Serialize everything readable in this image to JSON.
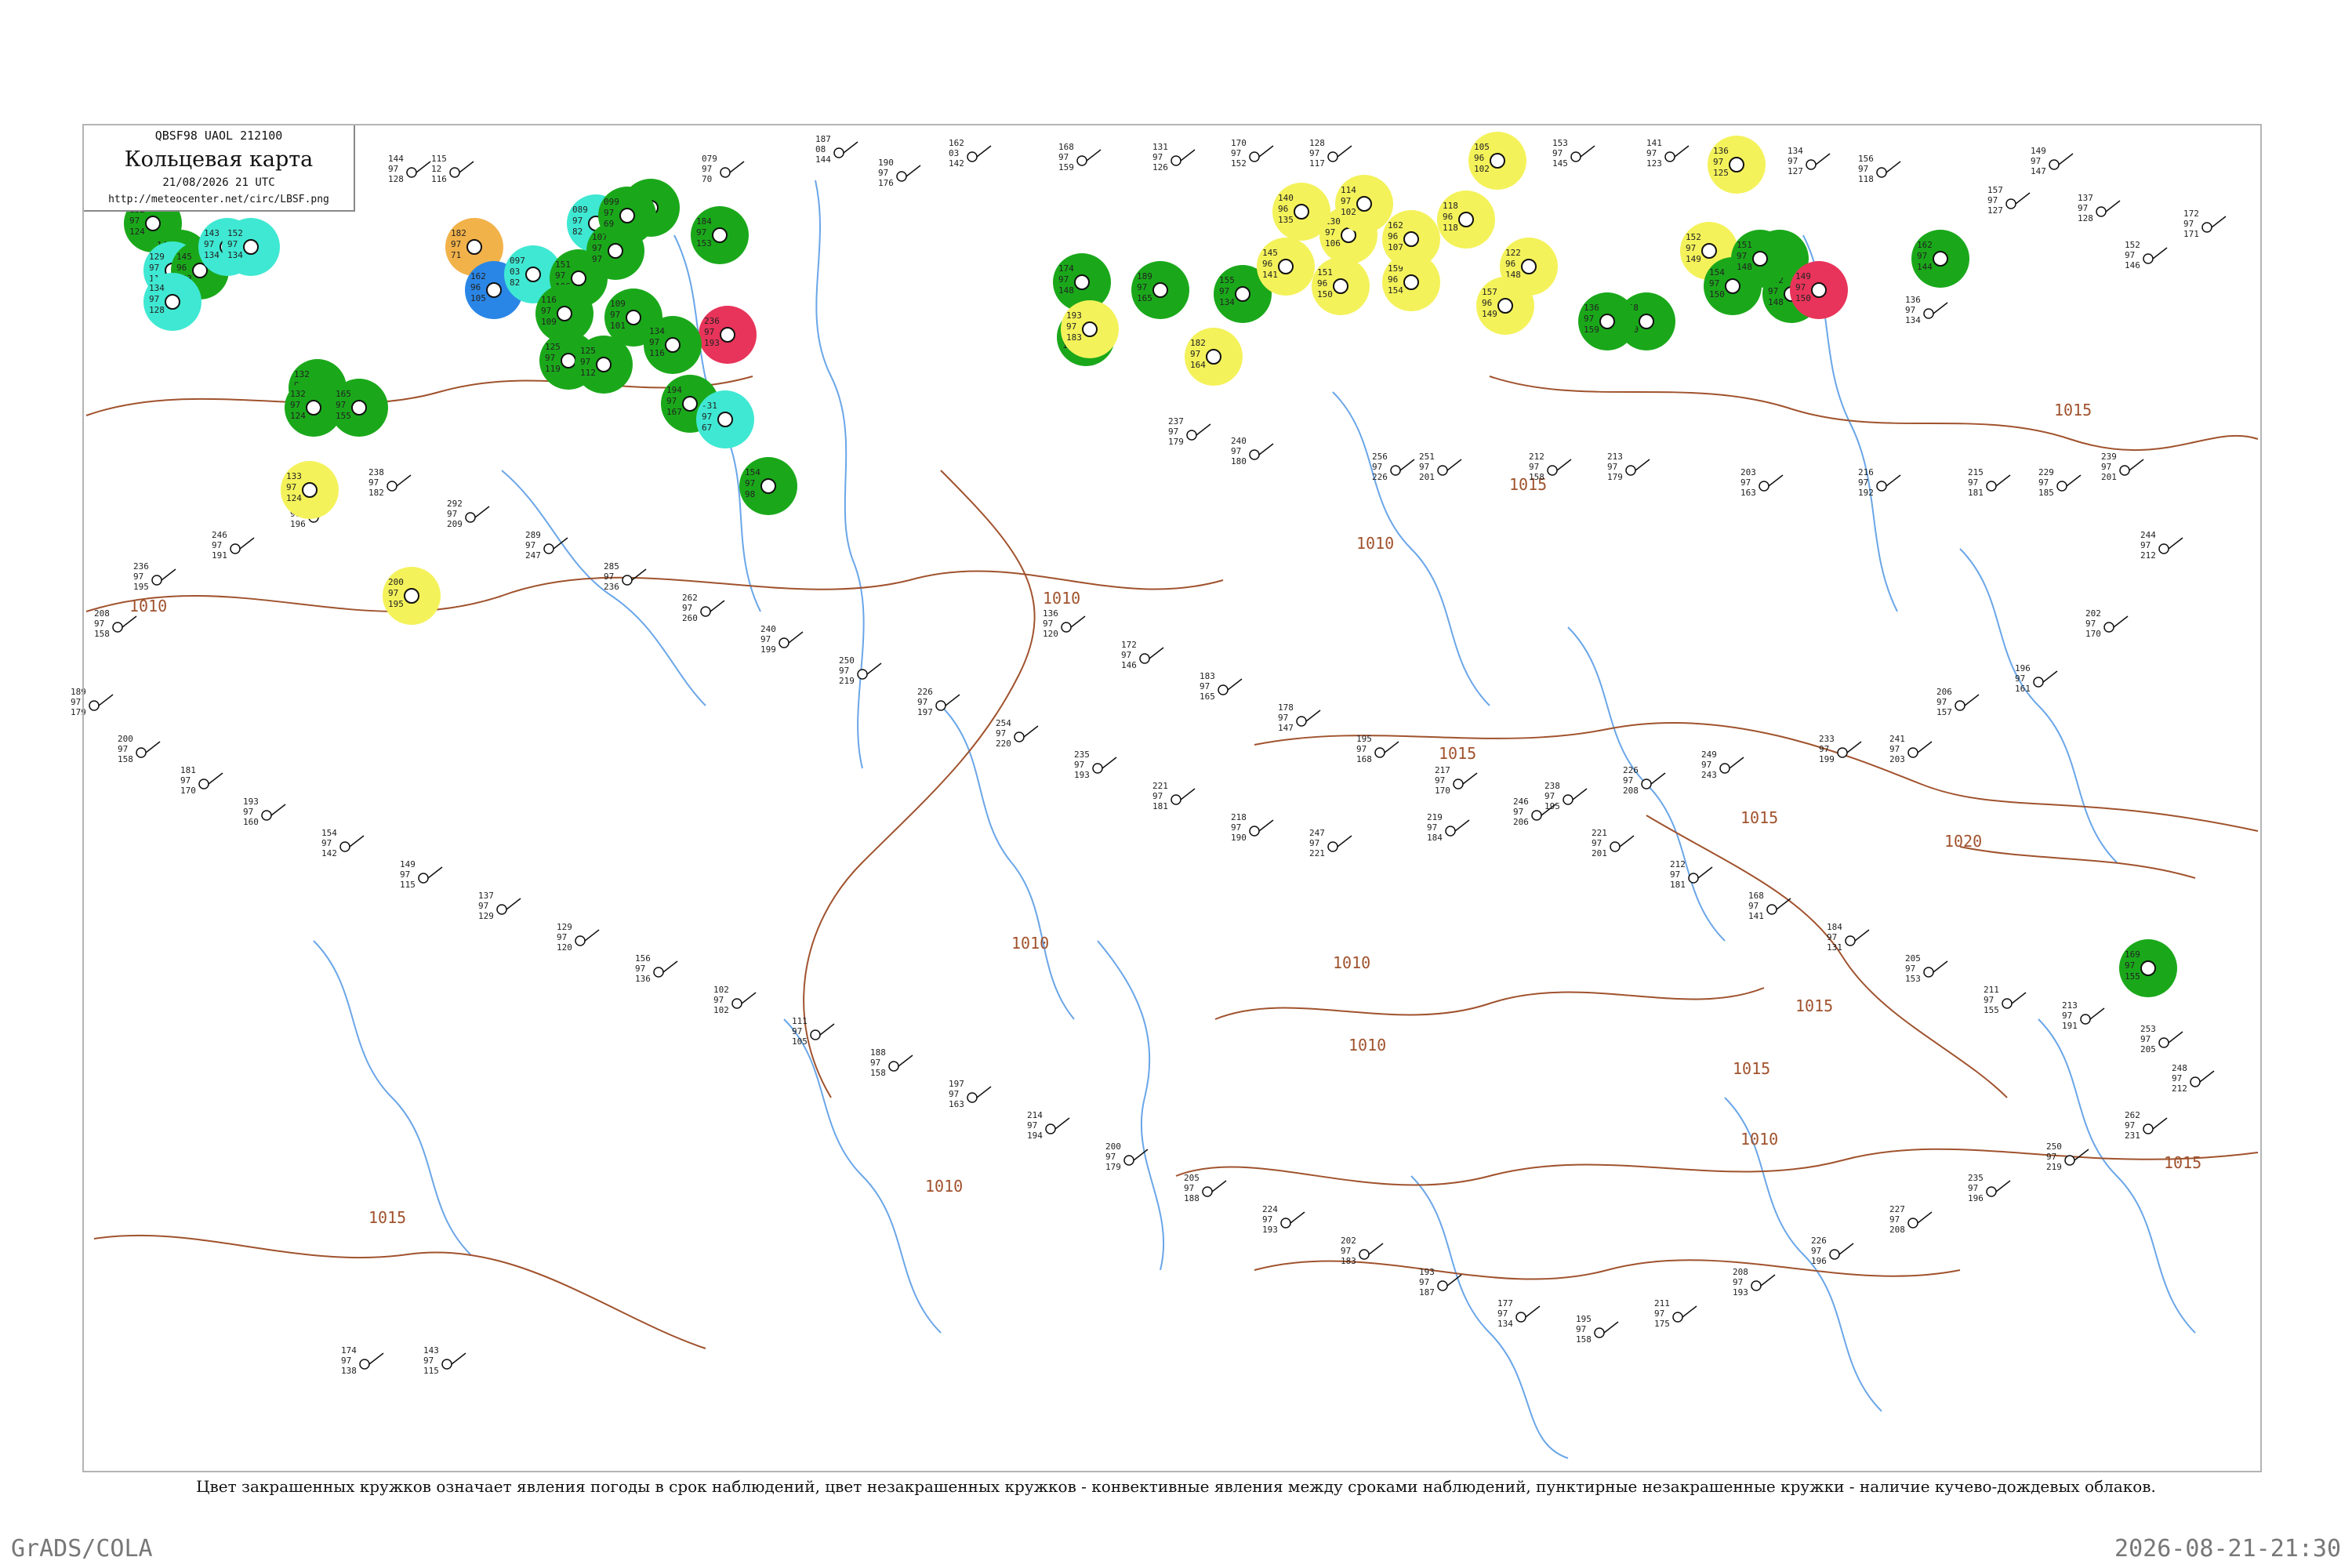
{
  "header": {
    "code_line": "QBSF98  UAOL  212100",
    "title": "Кольцевая карта",
    "date_line": "21/08/2026 21 UTC",
    "url": "http://meteocenter.net/circ/LBSF.png"
  },
  "caption": "Цвет закрашенных кружков означает явления погоды в срок наблюдений, цвет незакрашенных кружков - конвективные явления между сроками наблюдений, пунктирные незакрашенные кружки - наличие кучево-дождевых облаков.",
  "footer": {
    "left": "GrADS/COLA",
    "right": "2026-08-21-21:30"
  },
  "colors": {
    "green": "#1aa81a",
    "cyan": "#3fe8d2",
    "yellow": "#f4f25a",
    "orange": "#f2b24a",
    "blue": "#2a86e6",
    "red": "#e8345a",
    "isobar": "#a0522d",
    "river": "#6aa6e8",
    "frame": "#b4b4b4"
  },
  "isobar_labels": [
    "1010",
    "1010",
    "1010",
    "1010",
    "1010",
    "1010",
    "1010",
    "1010",
    "1015",
    "1015",
    "1015",
    "1015",
    "1015",
    "1015",
    "1015",
    "1015",
    "1020"
  ],
  "stations": [
    {
      "phenomenon": "green",
      "values": [
        "132",
        "97",
        "124"
      ]
    },
    {
      "phenomenon": "green",
      "values": [
        "144",
        "97",
        "117"
      ]
    },
    {
      "phenomenon": "cyan",
      "values": [
        "129",
        "97",
        "114"
      ]
    },
    {
      "phenomenon": "green",
      "values": [
        "145",
        "96",
        "133"
      ]
    },
    {
      "phenomenon": "cyan",
      "values": [
        "134",
        "97",
        "128"
      ]
    },
    {
      "phenomenon": "green",
      "values": [
        "132",
        "97",
        "125"
      ]
    },
    {
      "phenomenon": "cyan",
      "values": [
        "143",
        "97",
        "134"
      ]
    },
    {
      "phenomenon": "cyan",
      "values": [
        "152",
        "97",
        "134"
      ]
    },
    {
      "phenomenon": "orange",
      "values": [
        "182",
        "97",
        "71"
      ]
    },
    {
      "phenomenon": "blue",
      "values": [
        "162",
        "96",
        "105"
      ]
    },
    {
      "phenomenon": "cyan",
      "values": [
        "097",
        "03",
        "82"
      ]
    },
    {
      "phenomenon": "green",
      "values": [
        "151",
        "97",
        "106"
      ]
    },
    {
      "phenomenon": "cyan",
      "values": [
        "089",
        "97",
        "82"
      ]
    },
    {
      "phenomenon": "green",
      "values": [
        "085",
        "06",
        "89"
      ]
    },
    {
      "phenomenon": "green",
      "values": [
        "107",
        "97",
        "97"
      ]
    },
    {
      "phenomenon": "green",
      "values": [
        "116",
        "97",
        "109"
      ]
    },
    {
      "phenomenon": "green",
      "values": [
        "109",
        "97",
        "101"
      ]
    },
    {
      "phenomenon": "green",
      "values": [
        "125",
        "97",
        "119"
      ]
    },
    {
      "phenomenon": "green",
      "values": [
        "125",
        "97",
        "112"
      ]
    },
    {
      "phenomenon": "red",
      "values": [
        "236",
        "97",
        "193"
      ]
    },
    {
      "phenomenon": "green",
      "values": [
        "184",
        "97",
        "153"
      ]
    },
    {
      "phenomenon": "green",
      "values": [
        "194",
        "97",
        "167"
      ]
    },
    {
      "phenomenon": "cyan",
      "values": [
        "-31",
        "97",
        "67"
      ]
    },
    {
      "phenomenon": "green",
      "values": [
        "154",
        "97",
        "98"
      ]
    },
    {
      "phenomenon": "green",
      "values": [
        "099",
        "97",
        "69"
      ]
    },
    {
      "phenomenon": "green",
      "values": [
        "134",
        "97",
        "116"
      ]
    },
    {
      "phenomenon": "green",
      "values": [
        "132",
        "97",
        "124"
      ]
    },
    {
      "phenomenon": "green",
      "values": [
        "165",
        "97",
        "155"
      ]
    },
    {
      "phenomenon": "yellow",
      "values": [
        "133",
        "97",
        "124"
      ]
    },
    {
      "phenomenon": "yellow",
      "values": [
        "200",
        "97",
        "195"
      ]
    },
    {
      "phenomenon": "green",
      "values": [
        "174",
        "97",
        "148"
      ]
    },
    {
      "phenomenon": "green",
      "values": [
        "189",
        "97",
        "165"
      ]
    },
    {
      "phenomenon": "green",
      "values": [
        "155",
        "97",
        "134"
      ]
    },
    {
      "phenomenon": "green",
      "values": [
        "192",
        "97",
        "169"
      ]
    },
    {
      "phenomenon": "yellow",
      "values": [
        "193",
        "97",
        "183"
      ]
    },
    {
      "phenomenon": "yellow",
      "values": [
        "182",
        "97",
        "164"
      ]
    },
    {
      "phenomenon": "yellow",
      "values": [
        "130",
        "97",
        "106"
      ]
    },
    {
      "phenomenon": "yellow",
      "values": [
        "114",
        "97",
        "102"
      ]
    },
    {
      "phenomenon": "yellow",
      "values": [
        "151",
        "96",
        "150"
      ]
    },
    {
      "phenomenon": "yellow",
      "values": [
        "159",
        "96",
        "154"
      ]
    },
    {
      "phenomenon": "yellow",
      "values": [
        "162",
        "96",
        "107"
      ]
    },
    {
      "phenomenon": "yellow",
      "values": [
        "105",
        "96",
        "102"
      ]
    },
    {
      "phenomenon": "yellow",
      "values": [
        "118",
        "96",
        "118"
      ]
    },
    {
      "phenomenon": "yellow",
      "values": [
        "122",
        "96",
        "148"
      ]
    },
    {
      "phenomenon": "yellow",
      "values": [
        "157",
        "96",
        "149"
      ]
    },
    {
      "phenomenon": "yellow",
      "values": [
        "140",
        "96",
        "135"
      ]
    },
    {
      "phenomenon": "yellow",
      "values": [
        "145",
        "96",
        "141"
      ]
    },
    {
      "phenomenon": "green",
      "values": [
        "158",
        "97",
        "160"
      ]
    },
    {
      "phenomenon": "green",
      "values": [
        "136",
        "97",
        "159"
      ]
    },
    {
      "phenomenon": "yellow",
      "values": [
        "152",
        "97",
        "149"
      ]
    },
    {
      "phenomenon": "green",
      "values": [
        "149",
        "97",
        "149"
      ]
    },
    {
      "phenomenon": "green",
      "values": [
        "154",
        "97",
        "150"
      ]
    },
    {
      "phenomenon": "green",
      "values": [
        "152",
        "97",
        "148"
      ]
    },
    {
      "phenomenon": "red",
      "values": [
        "149",
        "97",
        "150"
      ]
    },
    {
      "phenomenon": "green",
      "values": [
        "151",
        "97",
        "148"
      ]
    },
    {
      "phenomenon": "green",
      "values": [
        "162",
        "97",
        "144"
      ]
    },
    {
      "phenomenon": "green",
      "values": [
        "169",
        "97",
        "155"
      ]
    },
    {
      "phenomenon": "yellow",
      "values": [
        "136",
        "97",
        "125"
      ]
    }
  ],
  "plain_stations": [
    [
      "144",
      "97",
      "128"
    ],
    [
      "115",
      "12",
      "116"
    ],
    [
      "079",
      "97",
      "70"
    ],
    [
      "187",
      "08",
      "144"
    ],
    [
      "190",
      "97",
      "176"
    ],
    [
      "162",
      "03",
      "142"
    ],
    [
      "168",
      "97",
      "159"
    ],
    [
      "131",
      "97",
      "126"
    ],
    [
      "170",
      "97",
      "152"
    ],
    [
      "128",
      "97",
      "117"
    ],
    [
      "130",
      "97",
      "124"
    ],
    [
      "153",
      "97",
      "145"
    ],
    [
      "141",
      "97",
      "123"
    ],
    [
      "134",
      "97",
      "127"
    ],
    [
      "156",
      "97",
      "118"
    ],
    [
      "149",
      "97",
      "147"
    ],
    [
      "137",
      "97",
      "128"
    ],
    [
      "152",
      "97",
      "146"
    ],
    [
      "172",
      "97",
      "171"
    ],
    [
      "157",
      "97",
      "127"
    ],
    [
      "136",
      "97",
      "134"
    ],
    [
      "237",
      "97",
      "179"
    ],
    [
      "240",
      "97",
      "180"
    ],
    [
      "256",
      "97",
      "226"
    ],
    [
      "251",
      "97",
      "201"
    ],
    [
      "212",
      "97",
      "158"
    ],
    [
      "213",
      "97",
      "179"
    ],
    [
      "203",
      "97",
      "163"
    ],
    [
      "216",
      "97",
      "192"
    ],
    [
      "215",
      "97",
      "181"
    ],
    [
      "229",
      "97",
      "185"
    ],
    [
      "239",
      "97",
      "201"
    ],
    [
      "244",
      "97",
      "212"
    ],
    [
      "202",
      "97",
      "170"
    ],
    [
      "196",
      "97",
      "161"
    ],
    [
      "206",
      "97",
      "157"
    ],
    [
      "241",
      "97",
      "203"
    ],
    [
      "233",
      "97",
      "199"
    ],
    [
      "249",
      "97",
      "243"
    ],
    [
      "226",
      "97",
      "208"
    ],
    [
      "238",
      "97",
      "195"
    ],
    [
      "219",
      "97",
      "184"
    ],
    [
      "247",
      "97",
      "221"
    ],
    [
      "218",
      "97",
      "190"
    ],
    [
      "221",
      "97",
      "181"
    ],
    [
      "235",
      "97",
      "193"
    ],
    [
      "254",
      "97",
      "220"
    ],
    [
      "226",
      "97",
      "197"
    ],
    [
      "250",
      "97",
      "219"
    ],
    [
      "240",
      "97",
      "199"
    ],
    [
      "262",
      "97",
      "260"
    ],
    [
      "285",
      "97",
      "236"
    ],
    [
      "289",
      "97",
      "247"
    ],
    [
      "292",
      "97",
      "209"
    ],
    [
      "238",
      "97",
      "182"
    ],
    [
      "245",
      "97",
      "196"
    ],
    [
      "246",
      "97",
      "191"
    ],
    [
      "236",
      "97",
      "195"
    ],
    [
      "208",
      "97",
      "158"
    ],
    [
      "189",
      "97",
      "179"
    ],
    [
      "200",
      "97",
      "158"
    ],
    [
      "181",
      "97",
      "170"
    ],
    [
      "193",
      "97",
      "160"
    ],
    [
      "154",
      "97",
      "142"
    ],
    [
      "149",
      "97",
      "115"
    ],
    [
      "137",
      "97",
      "129"
    ],
    [
      "129",
      "97",
      "120"
    ],
    [
      "156",
      "97",
      "136"
    ],
    [
      "102",
      "97",
      "102"
    ],
    [
      "111",
      "97",
      "105"
    ],
    [
      "188",
      "97",
      "158"
    ],
    [
      "197",
      "97",
      "163"
    ],
    [
      "214",
      "97",
      "194"
    ],
    [
      "200",
      "97",
      "179"
    ],
    [
      "205",
      "97",
      "188"
    ],
    [
      "224",
      "97",
      "193"
    ],
    [
      "202",
      "97",
      "183"
    ],
    [
      "193",
      "97",
      "187"
    ],
    [
      "177",
      "97",
      "134"
    ],
    [
      "195",
      "97",
      "158"
    ],
    [
      "211",
      "97",
      "175"
    ],
    [
      "208",
      "97",
      "193"
    ],
    [
      "226",
      "97",
      "196"
    ],
    [
      "227",
      "97",
      "208"
    ],
    [
      "235",
      "97",
      "196"
    ],
    [
      "250",
      "97",
      "219"
    ],
    [
      "262",
      "97",
      "231"
    ],
    [
      "248",
      "97",
      "212"
    ],
    [
      "253",
      "97",
      "205"
    ],
    [
      "213",
      "97",
      "191"
    ],
    [
      "211",
      "97",
      "155"
    ],
    [
      "205",
      "97",
      "153"
    ],
    [
      "184",
      "97",
      "131"
    ],
    [
      "168",
      "97",
      "141"
    ],
    [
      "212",
      "97",
      "181"
    ],
    [
      "221",
      "97",
      "201"
    ],
    [
      "246",
      "97",
      "206"
    ],
    [
      "217",
      "97",
      "170"
    ],
    [
      "195",
      "97",
      "168"
    ],
    [
      "178",
      "97",
      "147"
    ],
    [
      "183",
      "97",
      "165"
    ],
    [
      "172",
      "97",
      "146"
    ],
    [
      "136",
      "97",
      "120"
    ],
    [
      "174",
      "97",
      "138"
    ],
    [
      "143",
      "97",
      "115"
    ]
  ]
}
